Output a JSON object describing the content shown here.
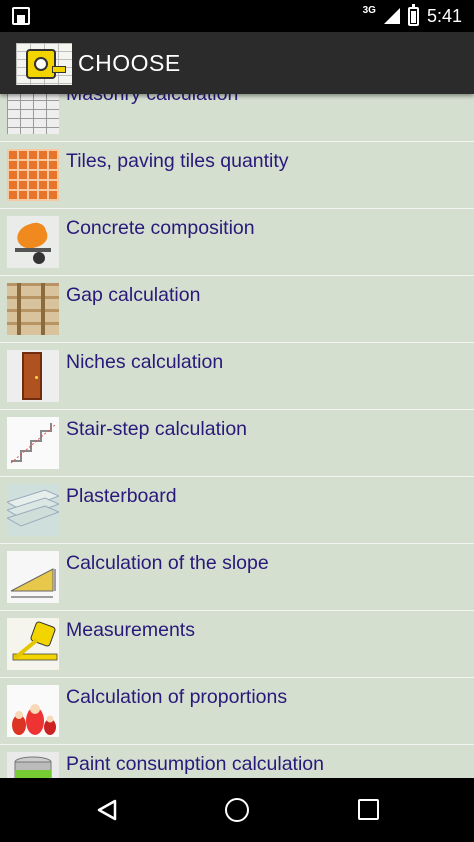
{
  "status_bar": {
    "network": "3G",
    "time": "5:41"
  },
  "app_bar": {
    "title": "CHOOSE",
    "logo_icon": "measuring-tape-house-icon"
  },
  "list": {
    "items": [
      {
        "label": "Masonry calculation",
        "icon": "brick-wall-icon"
      },
      {
        "label": "Tiles, paving tiles quantity",
        "icon": "tiles-icon"
      },
      {
        "label": "Concrete composition",
        "icon": "concrete-mixer-icon"
      },
      {
        "label": "Gap calculation",
        "icon": "wood-beams-icon"
      },
      {
        "label": "Niches calculation",
        "icon": "door-icon"
      },
      {
        "label": "Stair-step calculation",
        "icon": "stairs-icon"
      },
      {
        "label": "Plasterboard",
        "icon": "plasterboard-icon"
      },
      {
        "label": "Calculation of the slope",
        "icon": "slope-icon"
      },
      {
        "label": "Measurements",
        "icon": "measuring-tape-icon"
      },
      {
        "label": "Calculation of proportions",
        "icon": "nesting-dolls-icon"
      },
      {
        "label": "Paint consumption calculation",
        "icon": "paint-can-icon"
      }
    ]
  },
  "nav_bar": {
    "back_icon": "back-icon",
    "home_icon": "home-icon",
    "recents_icon": "recents-icon"
  },
  "colors": {
    "background": "#d5dfd0",
    "label_text": "#29197a",
    "app_bar": "#2b2b2b",
    "divider": "#f3f5f1"
  }
}
